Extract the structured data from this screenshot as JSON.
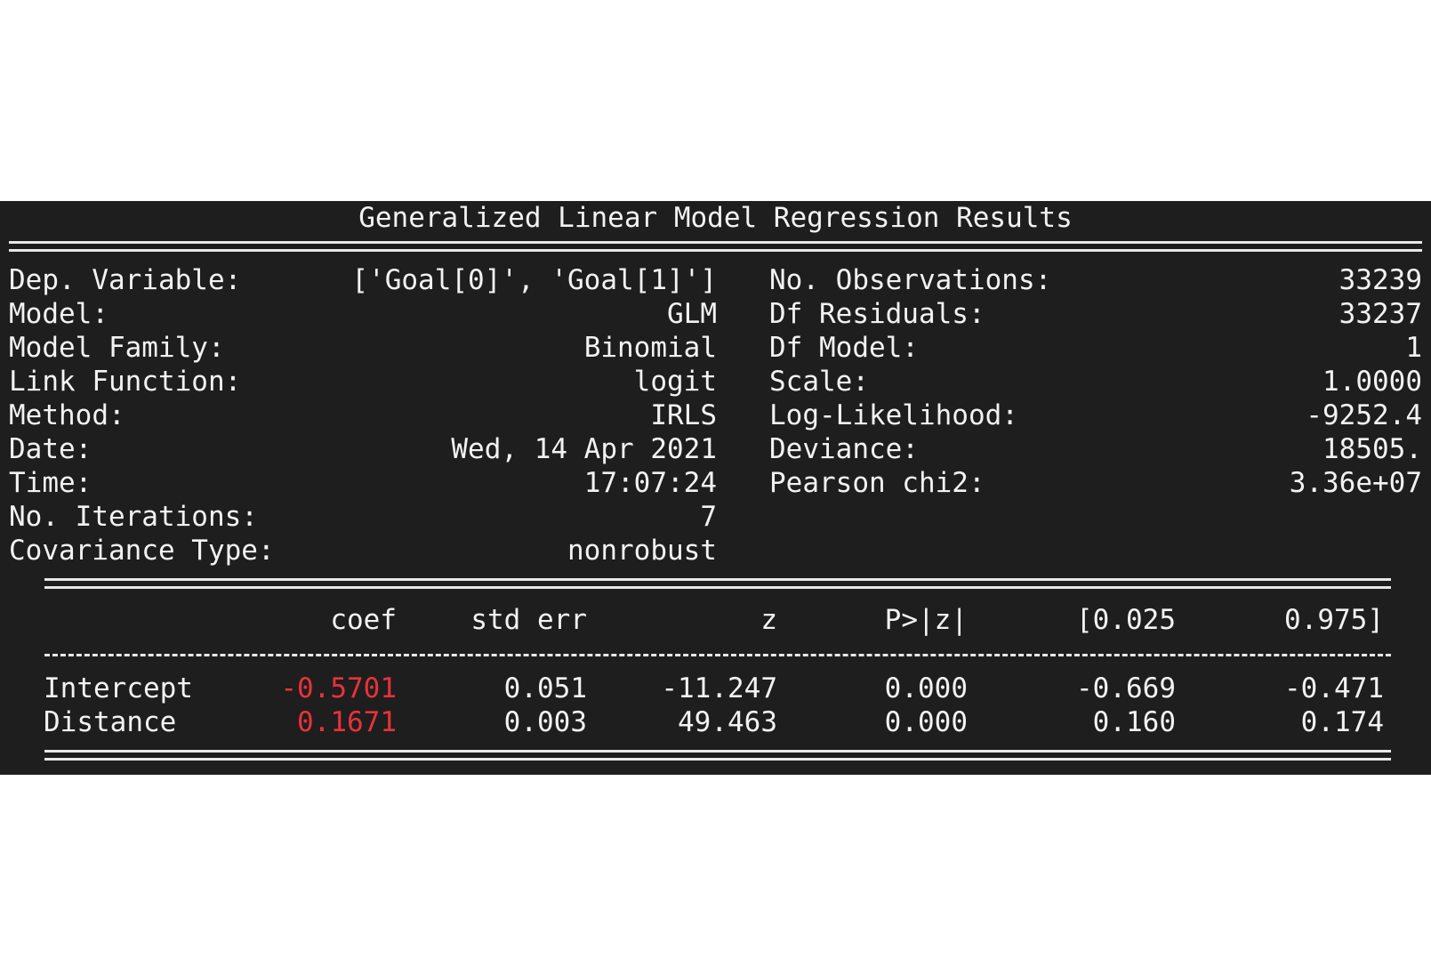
{
  "title": "Generalized Linear Model Regression Results",
  "left_stats": [
    {
      "label": "Dep. Variable:",
      "value": "['Goal[0]', 'Goal[1]']"
    },
    {
      "label": "Model:",
      "value": "GLM"
    },
    {
      "label": "Model Family:",
      "value": "Binomial"
    },
    {
      "label": "Link Function:",
      "value": "logit"
    },
    {
      "label": "Method:",
      "value": "IRLS"
    },
    {
      "label": "Date:",
      "value": "Wed, 14 Apr 2021"
    },
    {
      "label": "Time:",
      "value": "17:07:24"
    },
    {
      "label": "No. Iterations:",
      "value": "7"
    },
    {
      "label": "Covariance Type:",
      "value": "nonrobust"
    }
  ],
  "right_stats": [
    {
      "label": "No. Observations:",
      "value": "33239"
    },
    {
      "label": "Df Residuals:",
      "value": "33237"
    },
    {
      "label": "Df Model:",
      "value": "1"
    },
    {
      "label": "Scale:",
      "value": "1.0000"
    },
    {
      "label": "Log-Likelihood:",
      "value": "-9252.4"
    },
    {
      "label": "Deviance:",
      "value": "18505."
    },
    {
      "label": "Pearson chi2:",
      "value": "3.36e+07"
    }
  ],
  "coef_table": {
    "headers": [
      "coef",
      "std err",
      "z",
      "P>|z|",
      "[0.025",
      "0.975]"
    ],
    "rows": [
      {
        "name": "Intercept",
        "coef": "-0.5701",
        "std_err": "0.051",
        "z": "-11.247",
        "p": "0.000",
        "ci_low": "-0.669",
        "ci_high": "-0.471"
      },
      {
        "name": "Distance",
        "coef": "0.1671",
        "std_err": "0.003",
        "z": "49.463",
        "p": "0.000",
        "ci_low": "0.160",
        "ci_high": "0.174"
      }
    ]
  },
  "colors": {
    "background": "#1e1e1e",
    "text": "#f2f2f2",
    "highlight": "#e8323a"
  }
}
